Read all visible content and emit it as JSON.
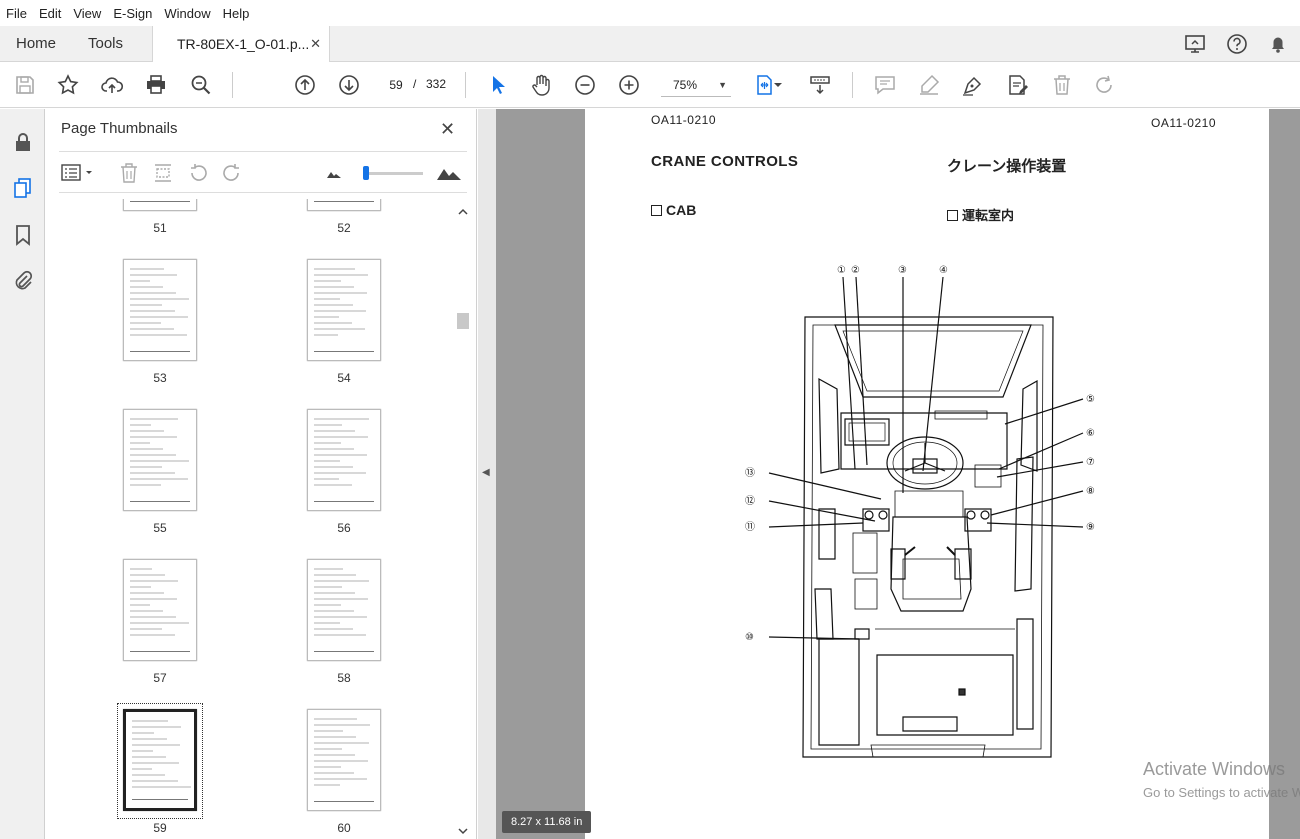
{
  "menu": [
    "File",
    "Edit",
    "View",
    "E-Sign",
    "Window",
    "Help"
  ],
  "tabs": {
    "home": "Home",
    "tools": "Tools",
    "document": "TR-80EX-1_O-01.p...",
    "close": "✕"
  },
  "toolbar": {
    "current_page": "59",
    "separator": "/",
    "total_pages": "332",
    "zoom": "75%"
  },
  "panel": {
    "title": "Page Thumbnails",
    "close": "✕",
    "thumbnails": [
      {
        "label": "51"
      },
      {
        "label": "52"
      },
      {
        "label": "53"
      },
      {
        "label": "54"
      },
      {
        "label": "55"
      },
      {
        "label": "56"
      },
      {
        "label": "57"
      },
      {
        "label": "58"
      },
      {
        "label": "59"
      },
      {
        "label": "60"
      }
    ]
  },
  "document": {
    "code_left": "OA11-0210",
    "code_right": "OA11-0210",
    "title": "CRANE CONTROLS",
    "title_jp": "クレーン操作装置",
    "section": "CAB",
    "section_jp": "運転室内",
    "callouts": [
      "①",
      "②",
      "③",
      "④",
      "⑤",
      "⑥",
      "⑦",
      "⑧",
      "⑨",
      "⑩",
      "⑪",
      "⑫",
      "⑬"
    ]
  },
  "status": {
    "page_size": "8.27 x 11.68 in"
  },
  "watermark": {
    "line1": "Activate Windows",
    "line2": "Go to Settings to activate Windows."
  }
}
